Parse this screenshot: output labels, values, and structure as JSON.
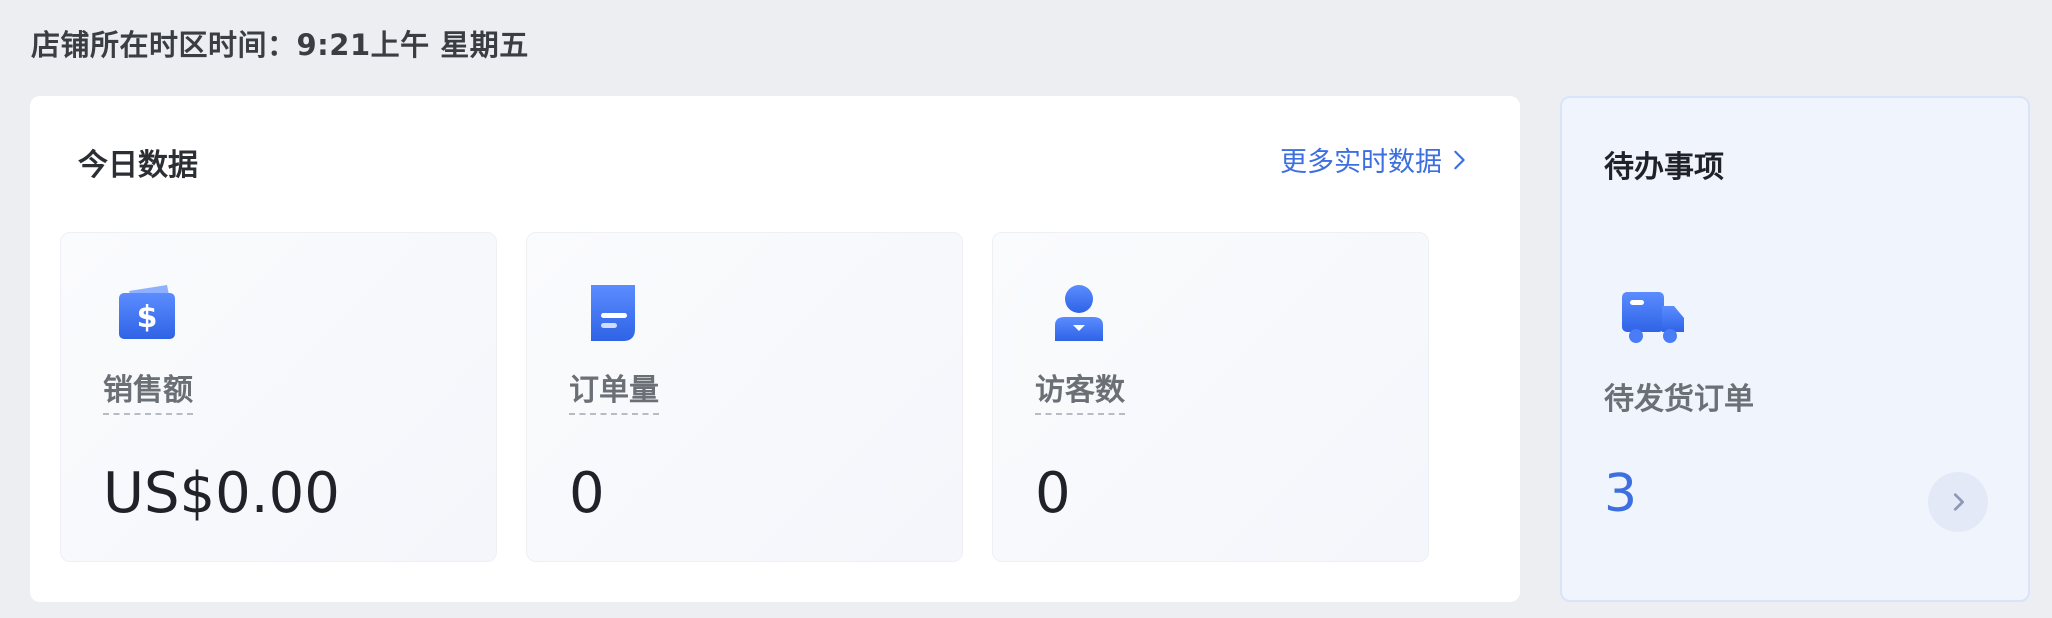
{
  "header": {
    "timezone_text": "店铺所在时区时间：9:21上午 星期五"
  },
  "today": {
    "title": "今日数据",
    "more_link": "更多实时数据",
    "stats": [
      {
        "label": "销售额",
        "value": "US$0.00",
        "icon": "wallet-dollar-icon"
      },
      {
        "label": "订单量",
        "value": "0",
        "icon": "document-icon"
      },
      {
        "label": "访客数",
        "value": "0",
        "icon": "user-icon"
      }
    ]
  },
  "todo": {
    "title": "待办事项",
    "label": "待发货订单",
    "count": "3",
    "icon": "truck-icon"
  },
  "colors": {
    "accent": "#3d6fe0",
    "icon_gradient_start": "#5b8cff",
    "icon_gradient_end": "#2f63e6",
    "todo_bg": "#f0f4fd"
  }
}
